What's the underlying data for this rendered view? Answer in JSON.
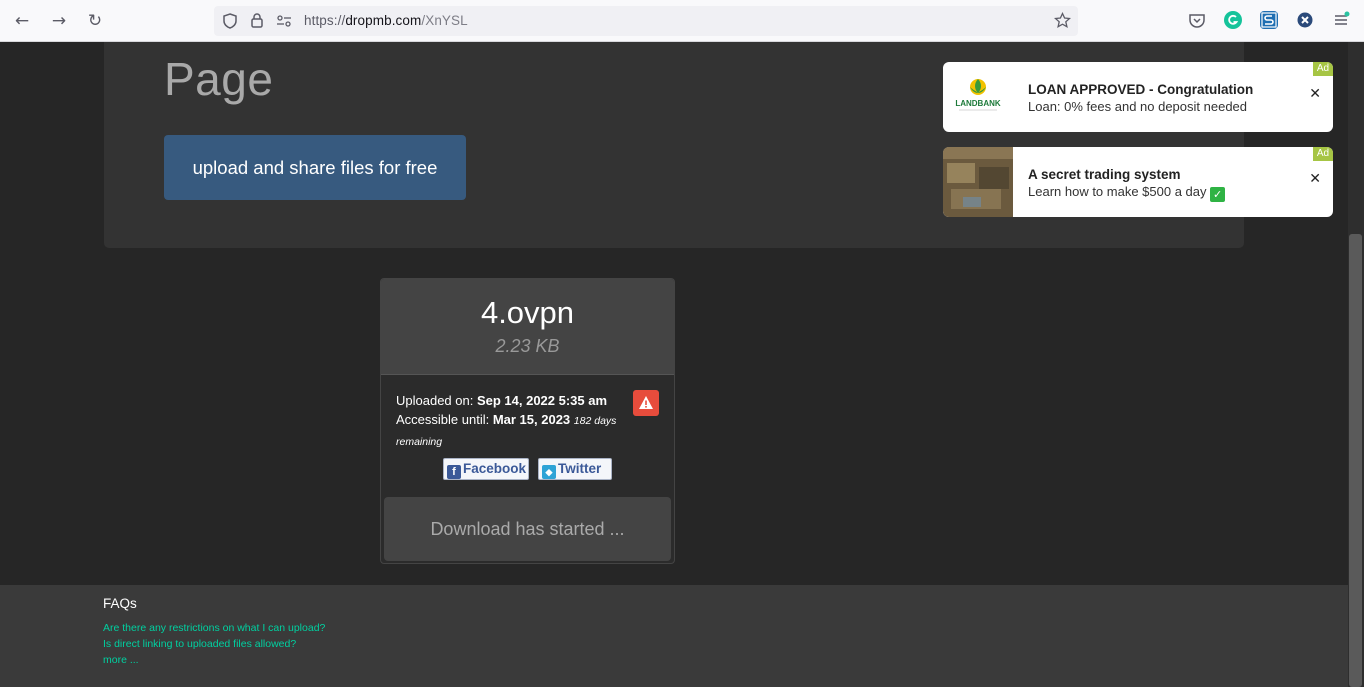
{
  "browser": {
    "url_scheme": "https://",
    "url_host": "dropmb.com",
    "url_path": "/XnYSL",
    "back_icon": "arrow-left-icon",
    "forward_icon": "arrow-right-icon",
    "reload_icon": "reload-icon"
  },
  "header": {
    "title": "Page",
    "cta_label": "upload and share files for free"
  },
  "ads": [
    {
      "title": "LOAN APPROVED - Congratulation",
      "description": "Loan: 0% fees and no deposit needed",
      "badge": "Ad",
      "close": "✕",
      "logo_text": "LANDBANK"
    },
    {
      "title": "A secret trading system",
      "description": "Learn how to make $500 a day",
      "badge": "Ad",
      "close": "✕"
    }
  ],
  "file": {
    "name": "4.ovpn",
    "size": "2.23 KB",
    "uploaded_label": "Uploaded on: ",
    "uploaded_value": "Sep 14, 2022 5:35 am",
    "accessible_label": "Accessible until: ",
    "accessible_value": "Mar 15, 2023",
    "days_remaining": "182 days remaining",
    "share_facebook": "Facebook",
    "share_twitter": "Twitter",
    "download_status": "Download has started ..."
  },
  "footer": {
    "faq_title": "FAQs",
    "links": [
      "Are there any restrictions on what I can upload?",
      "Is direct linking to uploaded files allowed?",
      "more ..."
    ]
  },
  "colors": {
    "cta_bg": "#375a7f",
    "report_bg": "#e74c3c",
    "faq_link": "#00d0a0",
    "ad_badge": "#a6c544"
  }
}
